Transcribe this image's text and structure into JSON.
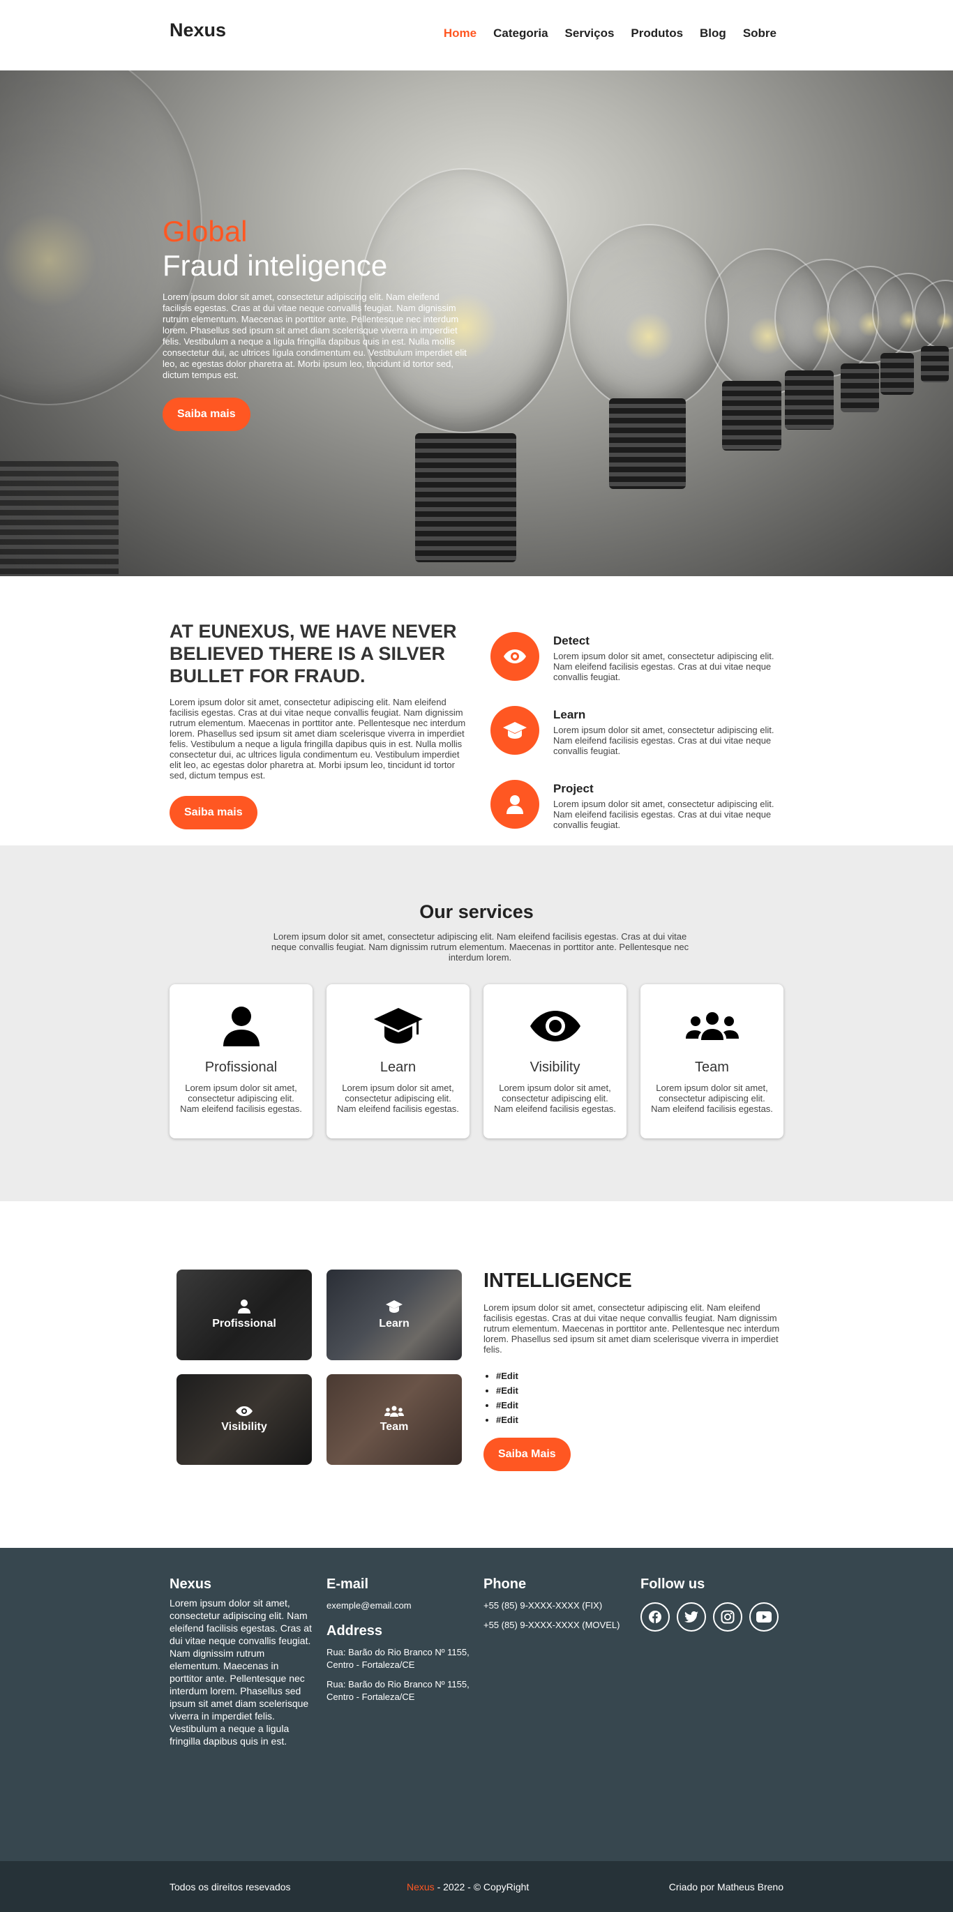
{
  "header": {
    "logo": "Nexus",
    "nav": [
      "Home",
      "Categoria",
      "Serviços",
      "Produtos",
      "Blog",
      "Sobre"
    ]
  },
  "hero": {
    "title_accent": "Global",
    "title_main": "Fraud inteligence",
    "text": "Lorem ipsum dolor sit amet, consectetur adipiscing elit. Nam eleifend facilisis egestas. Cras at dui vitae neque convallis feugiat. Nam dignissim rutrum elementum. Maecenas in porttitor ante. Pellentesque nec interdum lorem. Phasellus sed ipsum sit amet diam scelerisque viverra in imperdiet felis. Vestibulum a neque a ligula fringilla dapibus quis in est. Nulla mollis consectetur dui, ac ultrices ligula condimentum eu. Vestibulum imperdiet elit leo, ac egestas dolor pharetra at. Morbi ipsum leo, tincidunt id tortor sed, dictum tempus est.",
    "button": "Saiba mais"
  },
  "about": {
    "heading": "AT EUNEXUS, WE HAVE NEVER BELIEVED THERE IS A SILVER BULLET FOR FRAUD.",
    "text": "Lorem ipsum dolor sit amet, consectetur adipiscing elit. Nam eleifend facilisis egestas. Cras at dui vitae neque convallis feugiat. Nam dignissim rutrum elementum. Maecenas in porttitor ante. Pellentesque nec interdum lorem. Phasellus sed ipsum sit amet diam scelerisque viverra in imperdiet felis. Vestibulum a neque a ligula fringilla dapibus quis in est. Nulla mollis consectetur dui, ac ultrices ligula condimentum eu. Vestibulum imperdiet elit leo, ac egestas dolor pharetra at. Morbi ipsum leo, tincidunt id tortor sed, dictum tempus est.",
    "button": "Saiba mais",
    "features": [
      {
        "icon": "eye-icon",
        "title": "Detect",
        "text": "Lorem ipsum dolor sit amet, consectetur adipiscing elit. Nam eleifend facilisis egestas. Cras at dui vitae neque convallis feugiat."
      },
      {
        "icon": "graduation-cap-icon",
        "title": "Learn",
        "text": "Lorem ipsum dolor sit amet, consectetur adipiscing elit. Nam eleifend facilisis egestas. Cras at dui vitae neque convallis feugiat."
      },
      {
        "icon": "user-icon",
        "title": "Project",
        "text": "Lorem ipsum dolor sit amet, consectetur adipiscing elit. Nam eleifend facilisis egestas. Cras at dui vitae neque convallis feugiat."
      }
    ]
  },
  "services": {
    "title": "Our services",
    "subtitle": "Lorem ipsum dolor sit amet, consectetur adipiscing elit. Nam eleifend facilisis egestas. Cras at dui vitae neque convallis feugiat. Nam dignissim rutrum elementum. Maecenas in porttitor ante. Pellentesque nec interdum lorem.",
    "cards": [
      {
        "icon": "user-icon",
        "title": "Profissional",
        "text": "Lorem ipsum dolor sit amet, consectetur adipiscing elit. Nam eleifend facilisis egestas."
      },
      {
        "icon": "graduation-cap-icon",
        "title": "Learn",
        "text": "Lorem ipsum dolor sit amet, consectetur adipiscing elit. Nam eleifend facilisis egestas."
      },
      {
        "icon": "eye-icon",
        "title": "Visibility",
        "text": "Lorem ipsum dolor sit amet, consectetur adipiscing elit. Nam eleifend facilisis egestas."
      },
      {
        "icon": "users-icon",
        "title": "Team",
        "text": "Lorem ipsum dolor sit amet, consectetur adipiscing elit. Nam eleifend facilisis egestas."
      }
    ]
  },
  "intelligence": {
    "tiles": [
      "Profissional",
      "Learn",
      "Visibility",
      "Team"
    ],
    "title": "INTELLIGENCE",
    "text": "Lorem ipsum dolor sit amet, consectetur adipiscing elit. Nam eleifend facilisis egestas. Cras at dui vitae neque convallis feugiat. Nam dignissim rutrum elementum. Maecenas in porttitor ante. Pellentesque nec interdum lorem. Phasellus sed ipsum sit amet diam scelerisque viverra in imperdiet felis.",
    "list": [
      "#Edit",
      "#Edit",
      "#Edit",
      "#Edit"
    ],
    "button": "Saiba Mais"
  },
  "footer": {
    "about_title": "Nexus",
    "about_text": "Lorem ipsum dolor sit amet, consectetur adipiscing elit. Nam eleifend facilisis egestas. Cras at dui vitae neque convallis feugiat. Nam dignissim rutrum elementum. Maecenas in porttitor ante. Pellentesque nec interdum lorem. Phasellus sed ipsum sit amet diam scelerisque viverra in imperdiet felis. Vestibulum a neque a ligula fringilla dapibus quis in est.",
    "email_title": "E-mail",
    "email": "exemple@email.com",
    "address_title": "Address",
    "address_1": "Rua: Barão do Rio Branco Nº 1155, Centro - Fortaleza/CE",
    "address_2": "Rua: Barão do Rio Branco Nº 1155, Centro - Fortaleza/CE",
    "phone_title": "Phone",
    "phone_1": "+55 (85) 9-XXXX-XXXX (FIX)",
    "phone_2": "+55 (85) 9-XXXX-XXXX (MOVEL)",
    "follow_title": "Follow us",
    "social": [
      "facebook-icon",
      "twitter-icon",
      "instagram-icon",
      "youtube-icon"
    ]
  },
  "bottom": {
    "rights": "Todos os direitos resevados",
    "brand": "Nexus",
    "copy": " - 2022 - © CopyRight",
    "credit": "Criado por Matheus Breno"
  },
  "colors": {
    "accent": "#ff5722",
    "footer": "#37474f",
    "footer_bottom": "#263238",
    "services_bg": "#ececec"
  }
}
